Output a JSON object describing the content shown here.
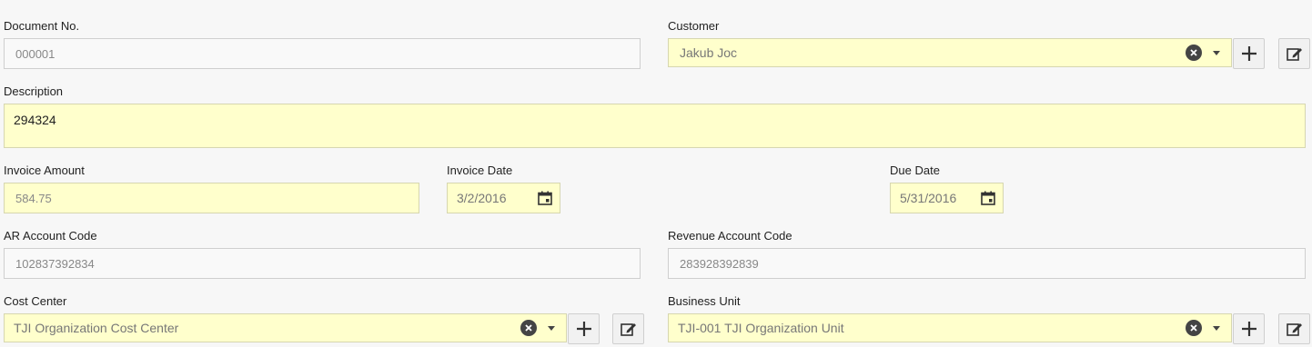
{
  "form": {
    "document_no": {
      "label": "Document No.",
      "value": "000001"
    },
    "customer": {
      "label": "Customer",
      "value": "Jakub Joc"
    },
    "description": {
      "label": "Description",
      "value": "294324"
    },
    "invoice_amount": {
      "label": "Invoice Amount",
      "value": "584.75"
    },
    "invoice_date": {
      "label": "Invoice Date",
      "value": "3/2/2016"
    },
    "due_date": {
      "label": "Due Date",
      "value": "5/31/2016"
    },
    "ar_account_code": {
      "label": "AR Account Code",
      "value": "102837392834"
    },
    "revenue_account_code": {
      "label": "Revenue Account Code",
      "value": "283928392839"
    },
    "cost_center": {
      "label": "Cost Center",
      "value": "TJI Organization Cost Center"
    },
    "business_unit": {
      "label": "Business Unit",
      "value": "TJI-001 TJI Organization Unit"
    }
  },
  "colors": {
    "required_bg": "#ffffcc",
    "readonly_bg": "#f9f9f9"
  },
  "icons": [
    "clear-icon",
    "dropdown-caret-icon",
    "plus-icon",
    "edit-icon",
    "calendar-icon"
  ]
}
